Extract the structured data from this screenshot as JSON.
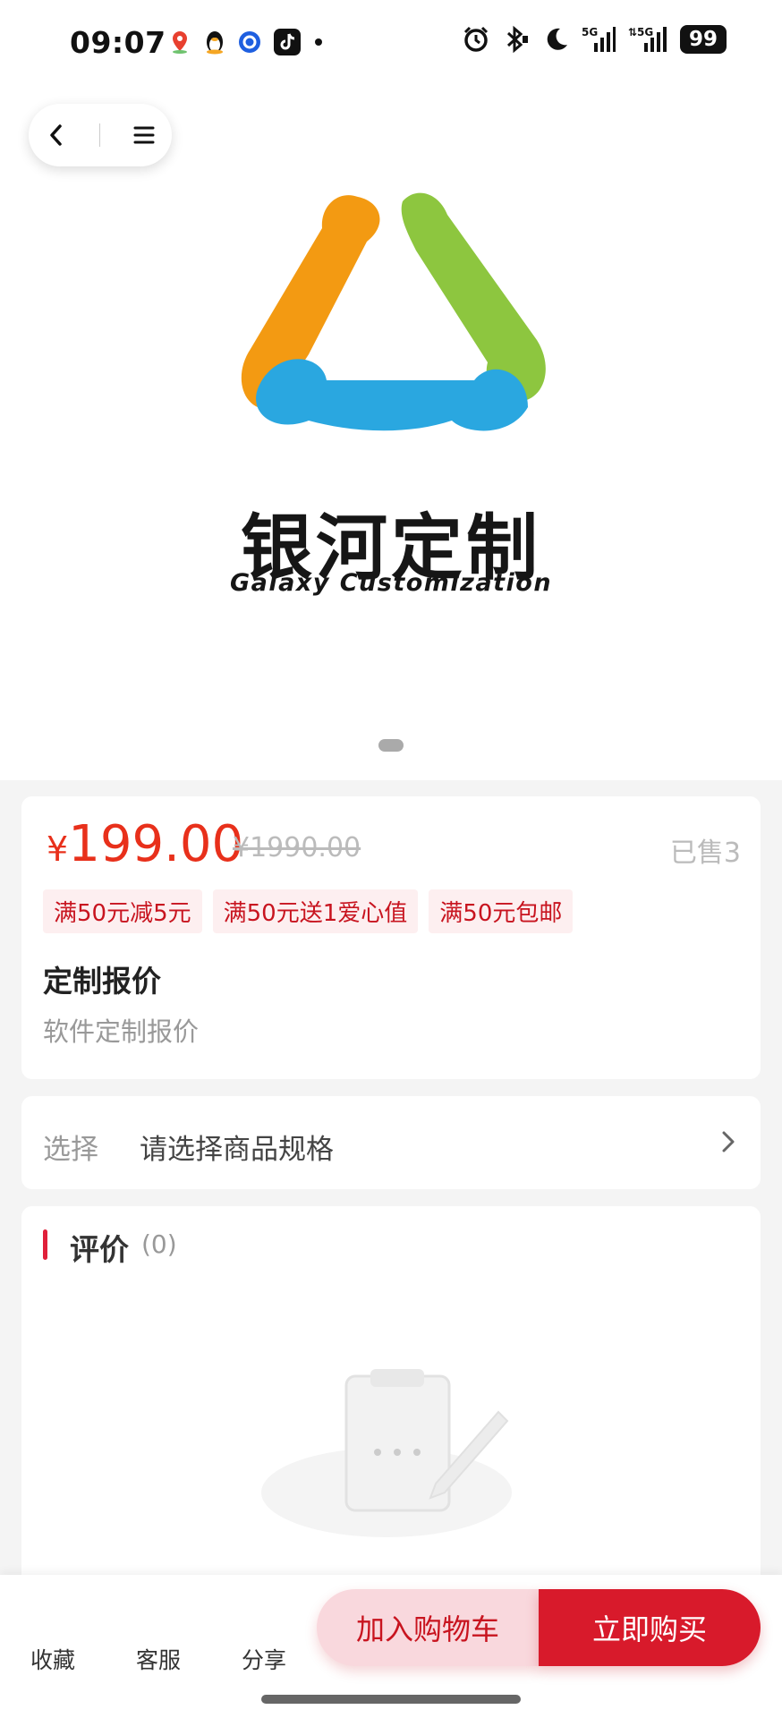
{
  "status_bar": {
    "time": "09:07",
    "battery": "99",
    "icons": [
      "map-pin-icon",
      "penguin-icon",
      "circle-app-icon",
      "tiktok-icon",
      "dot-icon",
      "alarm-icon",
      "bluetooth-icon",
      "moon-icon",
      "signal-5g-icon",
      "signal-5g-icon",
      "battery-icon"
    ]
  },
  "hero": {
    "logo_title": "银河定制",
    "logo_subtitle": "Galaxy Customization",
    "logo_colors": [
      "#f39a12",
      "#8dc63f",
      "#2aa7e0"
    ]
  },
  "product": {
    "currency": "¥",
    "price": "199.00",
    "original_price": "¥1990.00",
    "sold": "已售3",
    "promotions": [
      "满50元减5元",
      "满50元送1爱心值",
      "满50元包邮"
    ],
    "title": "定制报价",
    "description": "软件定制报价"
  },
  "spec": {
    "label": "选择",
    "value": "请选择商品规格"
  },
  "reviews": {
    "title": "评价",
    "count": "(0)"
  },
  "bottom_bar": {
    "favorite": "收藏",
    "service": "客服",
    "share": "分享",
    "add_to_cart": "加入购物车",
    "buy_now": "立即购买"
  },
  "colors": {
    "accent_red": "#d81a2b",
    "price_red": "#e8301b"
  }
}
